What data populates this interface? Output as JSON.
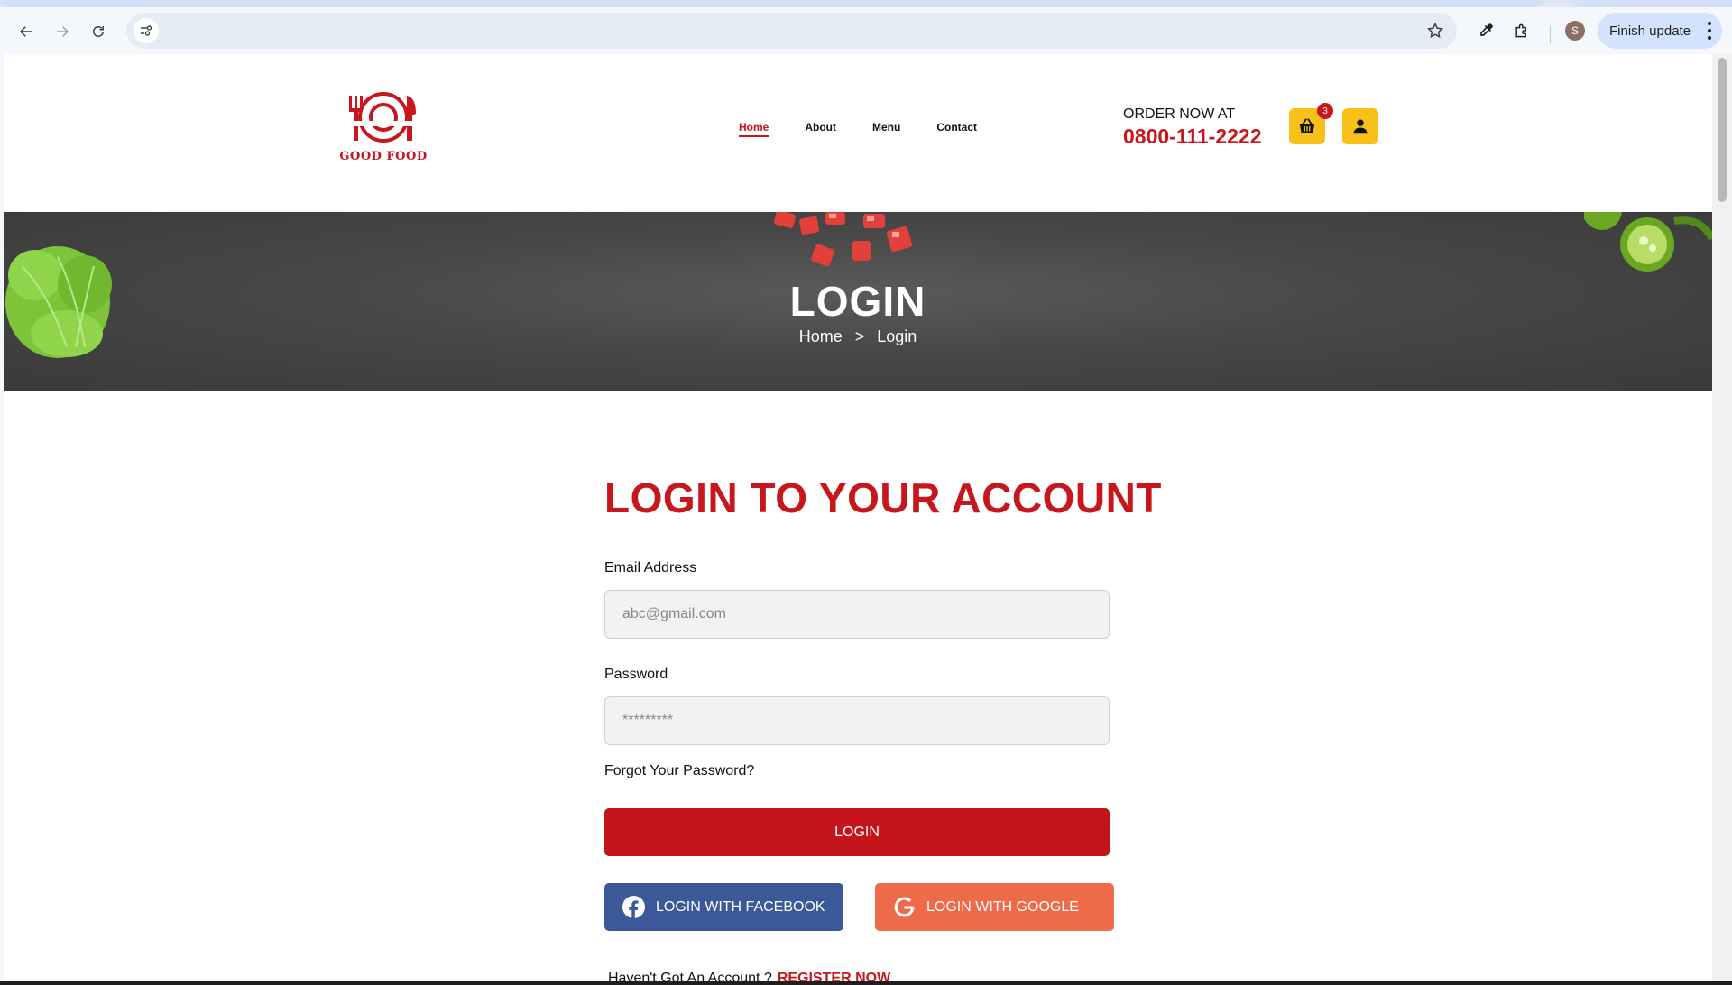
{
  "browser": {
    "finish_update_label": "Finish update",
    "profile_initial": "S"
  },
  "header": {
    "logo_text": "GOOD FOOD",
    "nav": [
      "Home",
      "About",
      "Menu",
      "Contact"
    ],
    "active_nav": "Home",
    "order_label": "ORDER NOW AT",
    "order_phone": "0800-111-2222",
    "cart_count": "3"
  },
  "banner": {
    "title": "LOGIN",
    "breadcrumb": [
      "Home",
      ">",
      "Login"
    ]
  },
  "login": {
    "heading": "LOGIN TO YOUR ACCOUNT",
    "email_label": "Email Address",
    "email_placeholder": "abc@gmail.com",
    "password_label": "Password",
    "password_value": "*********",
    "forgot_label": "Forgot Your Password?",
    "login_button": "LOGIN",
    "facebook_button": "LOGIN WITH FACEBOOK",
    "google_button": "LOGIN WITH GOOGLE",
    "no_account_text": "Haven't Got An Account ?",
    "register_link": "REGISTER NOW"
  },
  "colors": {
    "brand_red": "#c8161d",
    "accent_yellow": "#f7c11a",
    "facebook_blue": "#3b5998",
    "google_orange": "#ee6a48"
  }
}
